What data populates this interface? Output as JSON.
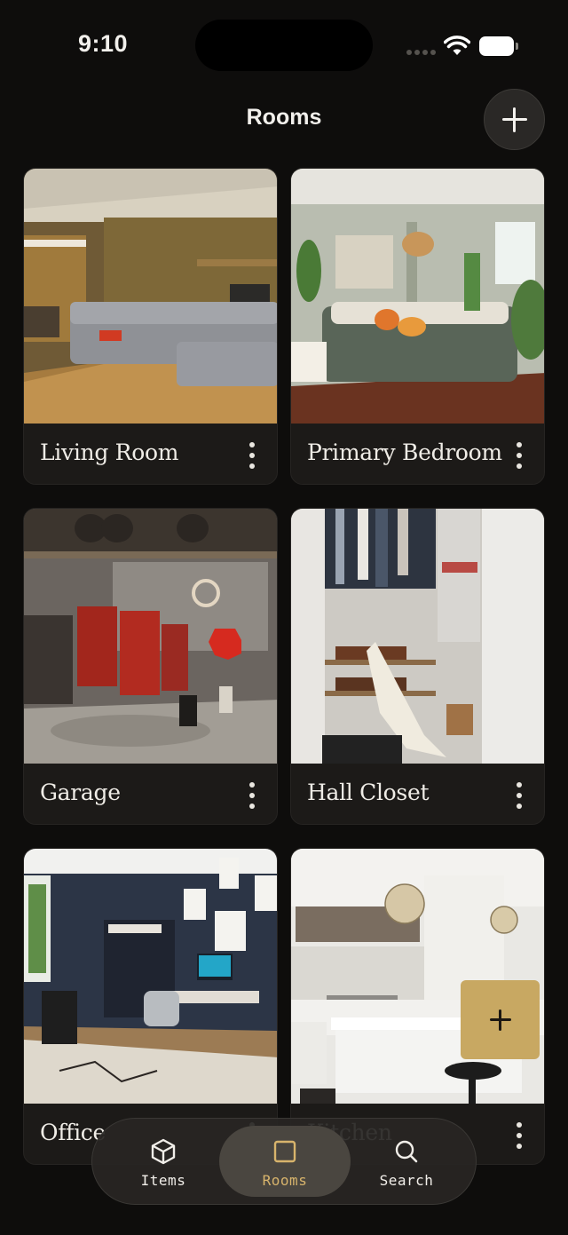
{
  "status_bar": {
    "time": "9:10"
  },
  "header": {
    "title": "Rooms",
    "add_icon": "plus-icon"
  },
  "rooms": [
    {
      "name": "Living Room",
      "menu_icon": "more-vertical-icon"
    },
    {
      "name": "Primary Bedroom",
      "menu_icon": "more-vertical-icon"
    },
    {
      "name": "Garage",
      "menu_icon": "more-vertical-icon"
    },
    {
      "name": "Hall Closet",
      "menu_icon": "more-vertical-icon"
    },
    {
      "name": "Office",
      "menu_icon": "more-vertical-icon"
    },
    {
      "name": "Kitchen",
      "menu_icon": "more-vertical-icon"
    }
  ],
  "fab": {
    "icon": "plus-icon"
  },
  "tabs": [
    {
      "label": "Items",
      "icon": "cube-icon"
    },
    {
      "label": "Rooms",
      "icon": "square-icon",
      "active": true
    },
    {
      "label": "Search",
      "icon": "search-icon"
    }
  ],
  "colors": {
    "background": "#0e0d0c",
    "accent": "#c8a862",
    "card": "#1c1a18"
  }
}
